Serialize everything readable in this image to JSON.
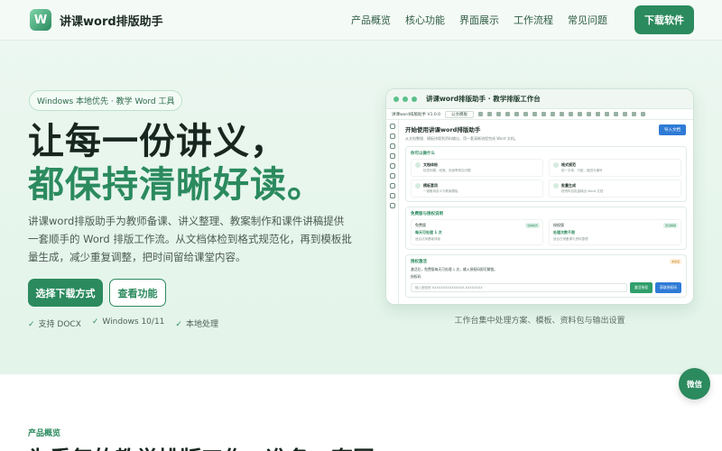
{
  "nav": {
    "logo_letter": "W",
    "brand": "讲课word排版助手",
    "links": [
      "产品概览",
      "核心功能",
      "界面展示",
      "工作流程",
      "常见问题"
    ],
    "cta": "下载软件"
  },
  "hero": {
    "pill": "Windows 本地优先 · 教学 Word 工具",
    "headline_line1": "让每一份讲义，",
    "headline_line2": "都保持清晰好读。",
    "description": "讲课word排版助手为教师备课、讲义整理、教案制作和课件讲稿提供一套顺手的 Word 排版工作流。从文档体检到格式规范化，再到模板批量生成，减少重复调整，把时间留给课堂内容。",
    "primary_button": "选择下载方式",
    "secondary_button": "查看功能",
    "checks": [
      "支持 DOCX",
      "Windows 10/11",
      "本地处理"
    ],
    "check_mark": "✓"
  },
  "mockup": {
    "window_title": "讲课word排版助手 · 教学排版工作台",
    "toolbar": {
      "app_label": "讲课word排版助手 V1.0.0",
      "select": "公文模板"
    },
    "heading": "开始使用讲课word排版助手",
    "subtitle": "从文档整理、模板排版到资料输出，用一套清晰流程完成 Word 文档。",
    "import_button": "导入文档",
    "card1_title": "你可以做什么",
    "features": [
      {
        "title": "文档体检",
        "desc": "检查标题、段落、页面等常见问题"
      },
      {
        "title": "格式规范",
        "desc": "统一字体、行距、缩进与编号"
      },
      {
        "title": "模板套用",
        "desc": "一键套用讲义与教案模板"
      },
      {
        "title": "批量生成",
        "desc": "按资料包批量输出 Word 文档"
      }
    ],
    "card2_title": "免费版与授权说明",
    "plans": [
      {
        "name": "免费版",
        "tag": "当前模式",
        "value": "每天可处理 1 次",
        "desc": "适合试用基础排版"
      },
      {
        "name": "授权版",
        "tag": "激活解锁",
        "value": "处理次数不限",
        "desc": "适合日常备课与资料整理"
      }
    ],
    "card3_title": "授权激活",
    "card3_badge": "未激活",
    "card3_line": "激活后，免费版每天可处理 1 次，输入授权码即可解锁。",
    "code_label": "授权码",
    "code_placeholder": "输入授权码 XXXXXXXXXXXXXXX-XXXXXXXX",
    "activate_button": "激活授权",
    "buy_button": "获取授权码"
  },
  "caption": "工作台集中处理方案、模板、资料包与输出设置",
  "wechat": "微信",
  "section": {
    "label": "产品概览",
    "title": "为重复的教学排版工作，准备一套固"
  }
}
